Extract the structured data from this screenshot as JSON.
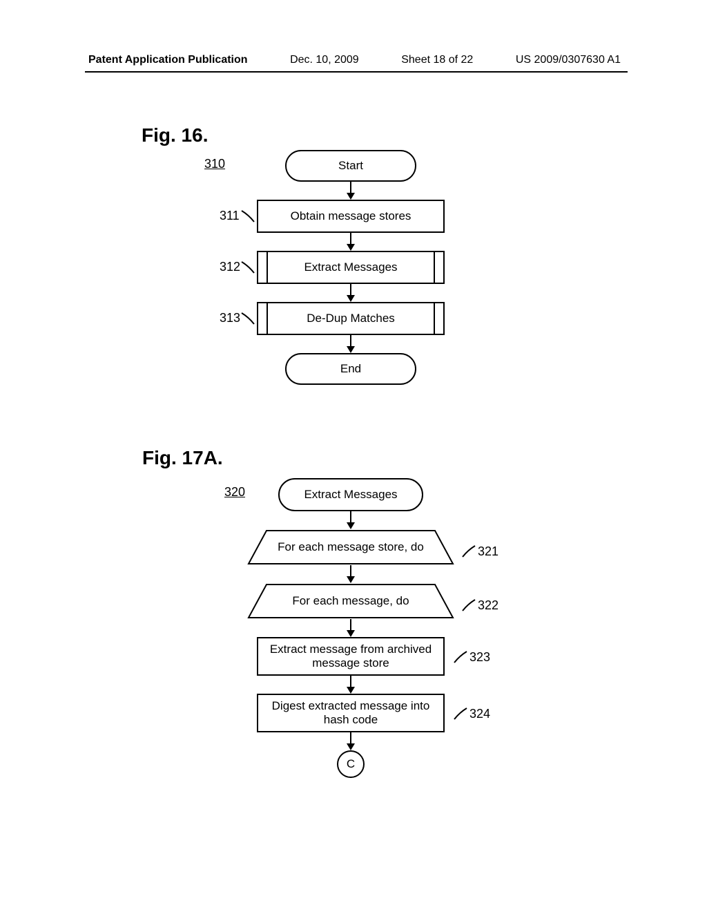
{
  "header": {
    "pub_label": "Patent Application Publication",
    "pub_date": "Dec. 10, 2009",
    "sheet_info": "Sheet 18 of 22",
    "pub_number": "US 2009/0307630 A1"
  },
  "fig16": {
    "title": "Fig. 16.",
    "ref": "310",
    "start": "Start",
    "step311": "Obtain message stores",
    "step311_ref": "311",
    "step312": "Extract Messages",
    "step312_ref": "312",
    "step313": "De-Dup Matches",
    "step313_ref": "313",
    "end": "End"
  },
  "fig17a": {
    "title": "Fig. 17A.",
    "ref": "320",
    "start": "Extract Messages",
    "loop321": "For each message store, do",
    "loop321_ref": "321",
    "loop322": "For each message, do",
    "loop322_ref": "322",
    "step323": "Extract message from archived message store",
    "step323_ref": "323",
    "step324": "Digest extracted message into hash code",
    "step324_ref": "324",
    "connector": "C"
  }
}
